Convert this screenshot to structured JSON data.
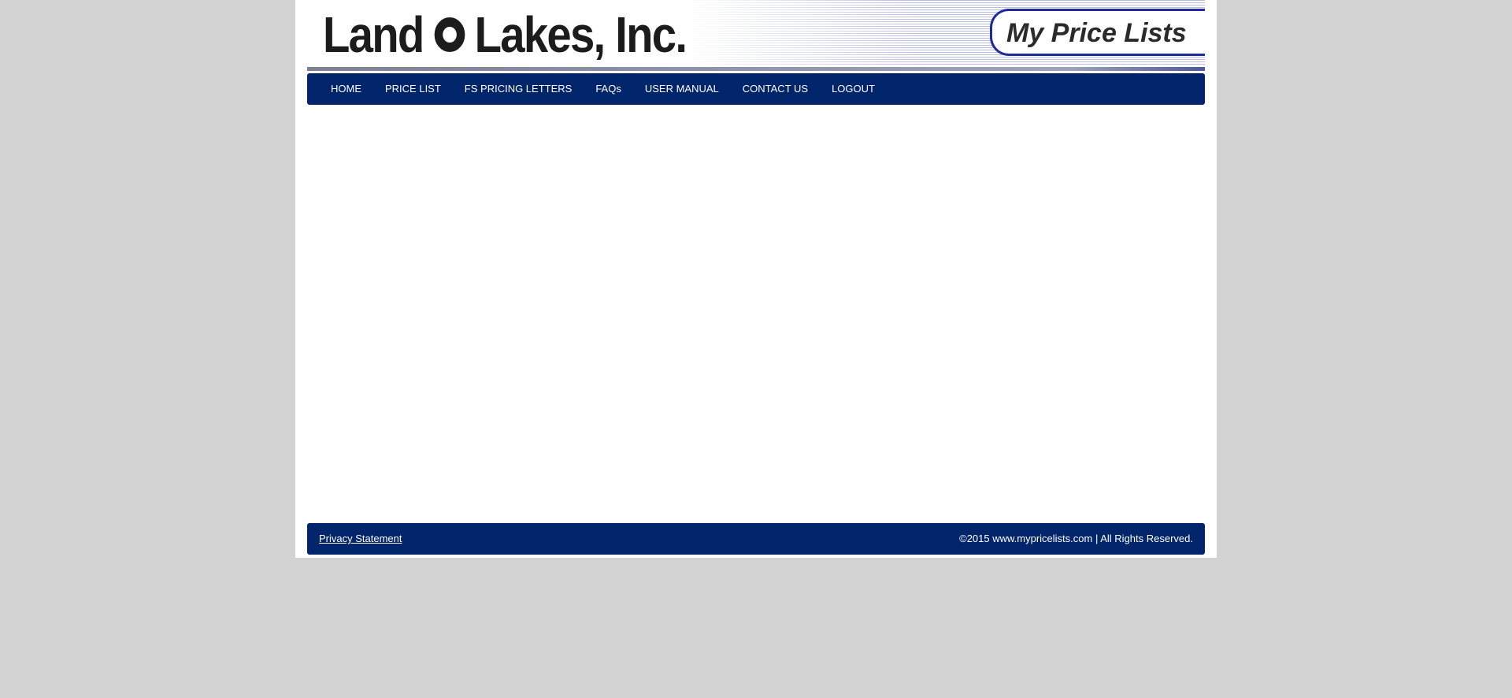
{
  "header": {
    "logo_text_left": "Land",
    "logo_text_right": "Lakes, Inc.",
    "badge_text": "My Price Lists"
  },
  "nav": {
    "items": [
      {
        "label": "HOME"
      },
      {
        "label": "PRICE LIST"
      },
      {
        "label": "FS PRICING LETTERS"
      },
      {
        "label": "FAQs"
      },
      {
        "label": "USER MANUAL"
      },
      {
        "label": "CONTACT US"
      },
      {
        "label": "LOGOUT"
      }
    ]
  },
  "footer": {
    "privacy_label": "Privacy Statement",
    "copyright": "©2015 www.mypricelists.com | All Rights Reserved."
  },
  "colors": {
    "brand_navy": "#00256a",
    "badge_border": "#1f2a9c",
    "page_background": "#d3d3d3"
  }
}
